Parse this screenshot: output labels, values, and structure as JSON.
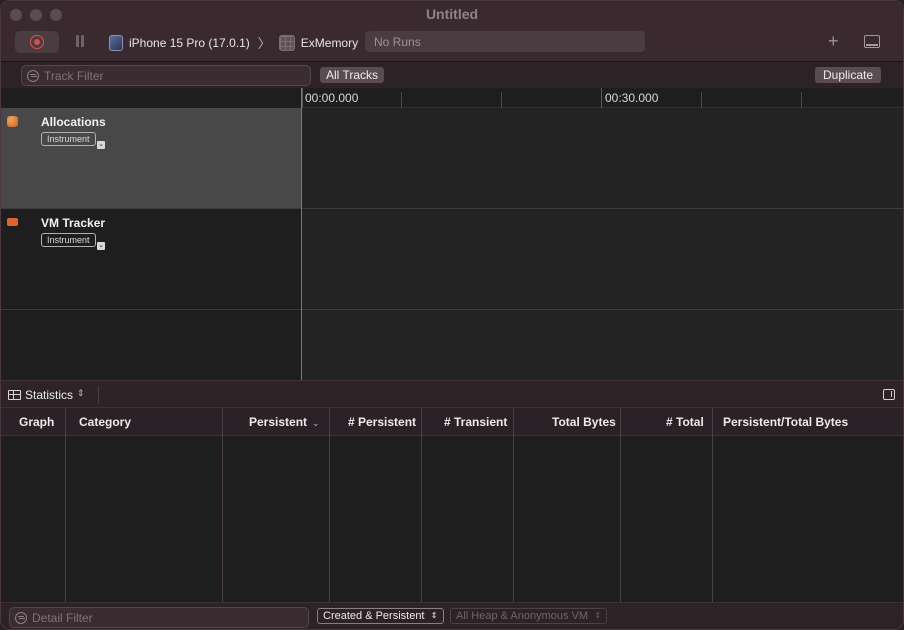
{
  "window": {
    "title": "Untitled"
  },
  "toolbar": {
    "device_name": "iPhone 15 Pro (17.0.1)",
    "separator": "〉",
    "target_name": "ExMemory",
    "runs_label": "No Runs",
    "plus_label": "+"
  },
  "filters": {
    "track_filter_placeholder": "Track Filter",
    "all_tracks_label": "All Tracks",
    "duplicate_label": "Duplicate"
  },
  "timeline": {
    "ticks": [
      "00:00.000",
      "00:30.000"
    ]
  },
  "tracks": [
    {
      "name": "Allocations",
      "badge": "Instrument",
      "icon": "allocations-icon",
      "color": "#e0652a"
    },
    {
      "name": "VM Tracker",
      "badge": "Instrument",
      "icon": "vm-tracker-icon",
      "color": "#e0652a"
    }
  ],
  "detail": {
    "view_label": "Statistics",
    "columns": [
      "Graph",
      "Category",
      "Persistent",
      "# Persistent",
      "# Transient",
      "Total Bytes",
      "# Total",
      "Persistent/Total Bytes"
    ],
    "sorted_column": "Persistent",
    "rows": []
  },
  "bottom": {
    "detail_filter_placeholder": "Detail Filter",
    "lifespan_option": "Created & Persistent",
    "allocation_type_option": "All Heap & Anonymous VM"
  },
  "colors": {
    "record": "#e04a45",
    "accent": "#e0652a"
  }
}
